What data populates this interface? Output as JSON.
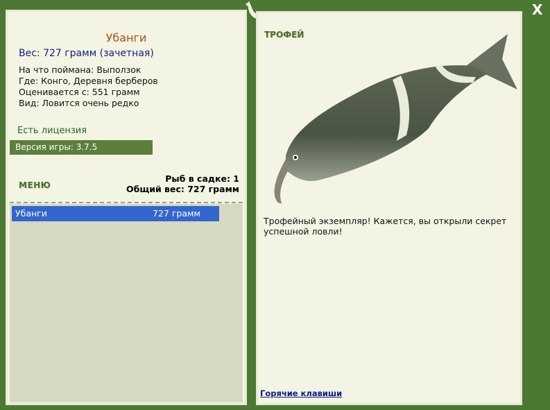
{
  "window": {
    "close_label": "X"
  },
  "fish": {
    "name": "Убанги",
    "weight_line": "Вес: 727 грамм (зачетная)",
    "caught_on": "На что поймана: Выползок",
    "location": "Где: Конго, Деревня берберов",
    "rated_from": "Оценивается с: 551 грамм",
    "rarity": "Вид: Ловится очень редко"
  },
  "license": "Есть лицензия",
  "version": "Версия игры: 3.7.5",
  "menu_label": "МЕНЮ",
  "keepnet": {
    "count_line": "Рыб в садке: 1",
    "total_line": "Общий вес: 727 грамм",
    "items": [
      {
        "name": "Убанги",
        "weight": "727 грамм"
      }
    ]
  },
  "trophy": {
    "label": "ТРОФЕЙ",
    "description": "Трофейный экземпляр! Кажется, вы открыли секрет успешной ловли!"
  },
  "hotkeys_label": "Горячие клавиши",
  "colors": {
    "frame": "#4d7833",
    "panel": "#f4f4e4",
    "selected": "#3366cc",
    "title": "#b04a10"
  }
}
